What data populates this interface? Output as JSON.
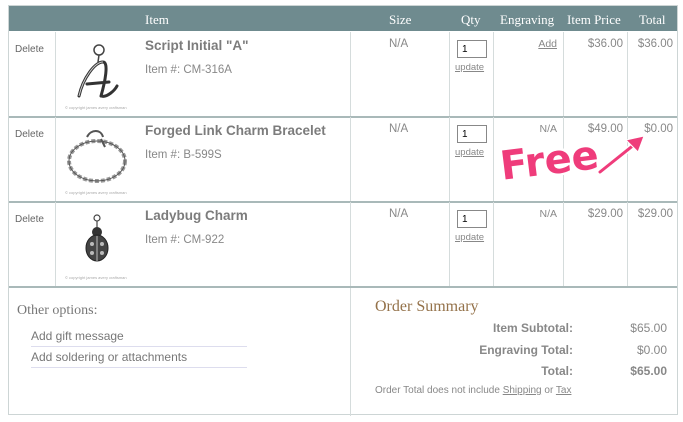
{
  "header": {
    "item": "Item",
    "size": "Size",
    "qty": "Qty",
    "engraving": "Engraving",
    "item_price": "Item Price",
    "total": "Total"
  },
  "rows": [
    {
      "delete": "Delete",
      "name": "Script Initial \"A\"",
      "item_number": "Item #: CM-316A",
      "size": "N/A",
      "qty": "1",
      "update": "update",
      "engraving": "Add",
      "price": "$36.00",
      "total": "$36.00",
      "copyright": "© copyright james avery craftsman",
      "thumb_icon": "script-a-charm"
    },
    {
      "delete": "Delete",
      "name": "Forged Link Charm Bracelet",
      "item_number": "Item #: B-599S",
      "size": "N/A",
      "qty": "1",
      "update": "update",
      "engraving": "N/A",
      "price": "$49.00",
      "total": "$0.00",
      "copyright": "© copyright james avery craftsman",
      "thumb_icon": "charm-bracelet"
    },
    {
      "delete": "Delete",
      "name": "Ladybug Charm",
      "item_number": "Item #: CM-922",
      "size": "N/A",
      "qty": "1",
      "update": "update",
      "engraving": "N/A",
      "price": "$29.00",
      "total": "$29.00",
      "copyright": "© copyright james avery craftsman",
      "thumb_icon": "ladybug-charm"
    }
  ],
  "other_options": {
    "title": "Other options:",
    "items": [
      "Add gift message",
      "Add soldering or attachments"
    ]
  },
  "summary": {
    "title": "Order Summary",
    "subtotal_label": "Item Subtotal:",
    "subtotal_value": "$65.00",
    "engraving_label": "Engraving Total:",
    "engraving_value": "$0.00",
    "total_label": "Total:",
    "total_value": "$65.00",
    "note_prefix": "Order Total does not include",
    "note_shipping": "Shipping",
    "note_or": "or",
    "note_tax": "Tax"
  },
  "annotation": {
    "text": "Free",
    "color": "#ef3c7b"
  },
  "colors": {
    "header_bg": "#6f8b8f",
    "summary_title": "#94724a"
  }
}
